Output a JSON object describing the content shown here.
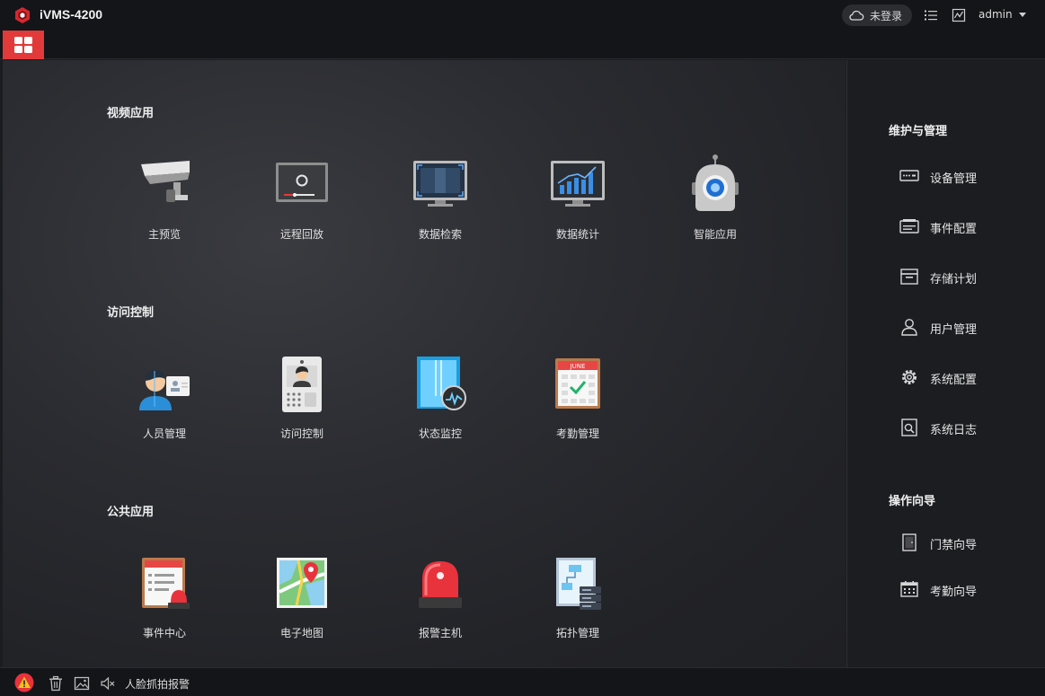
{
  "app": {
    "title": "iVMS-4200",
    "brand_color": "#e23a3a"
  },
  "header": {
    "login_status": "未登录",
    "username": "admin"
  },
  "sections": {
    "video": {
      "title": "视频应用",
      "items": [
        "主预览",
        "远程回放",
        "数据检索",
        "数据统计",
        "智能应用"
      ]
    },
    "access": {
      "title": "访问控制",
      "items": [
        "人员管理",
        "访问控制",
        "状态监控",
        "考勤管理"
      ]
    },
    "common": {
      "title": "公共应用",
      "items": [
        "事件中心",
        "电子地图",
        "报警主机",
        "拓扑管理"
      ]
    }
  },
  "calendar_month": "JUNE",
  "side": {
    "maintenance_title": "维护与管理",
    "maintenance_items": [
      "设备管理",
      "事件配置",
      "存储计划",
      "用户管理",
      "系统配置",
      "系统日志"
    ],
    "guide_title": "操作向导",
    "guide_items": [
      "门禁向导",
      "考勤向导"
    ]
  },
  "statusbar": {
    "message": "人脸抓拍报警"
  }
}
